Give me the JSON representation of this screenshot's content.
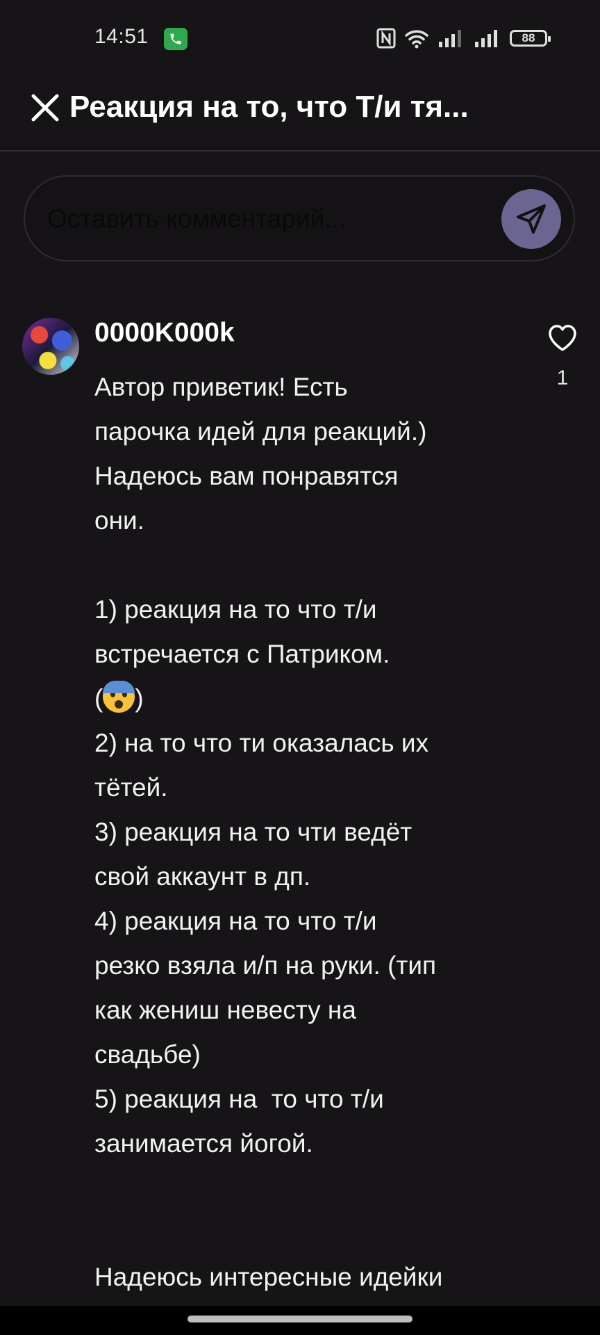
{
  "status_bar": {
    "time": "14:51",
    "battery": "88",
    "icons": [
      "call-icon",
      "nfc-icon",
      "wifi-icon",
      "signal-icon",
      "signal-icon",
      "battery-icon"
    ]
  },
  "header": {
    "title": "Реакция на то, что Т/и тя...",
    "close_icon": "close-icon"
  },
  "comment_input": {
    "placeholder": "Оставить комментарий...",
    "value": "",
    "send_icon": "send-icon",
    "accent_color": "#6b6592"
  },
  "comment": {
    "username": "0000K000k",
    "likes": "1",
    "like_icon": "heart-icon",
    "lines": [
      "Автор приветик! Есть",
      "парочка идей для реакций.)",
      "Надеюсь вам понравятся",
      "они.",
      "",
      "1) реакция на то что т/и",
      "встречается с Патриком.",
      "(",
      "2) на то что ти оказалась их",
      "тётей.",
      "3) реакция на то чти ведёт",
      "свой аккаунт в дп.",
      "4) реакция на то что т/и",
      "резко взяла и/п на руки. (тип",
      "как жениш невесту на",
      "свадьбе)",
      "5) реакция на  то что т/и",
      "занимается йогой.",
      "",
      "",
      "Надеюсь интересные идейки"
    ],
    "emoji_line_suffix": ")",
    "emoji": "fearful-face-emoji"
  }
}
